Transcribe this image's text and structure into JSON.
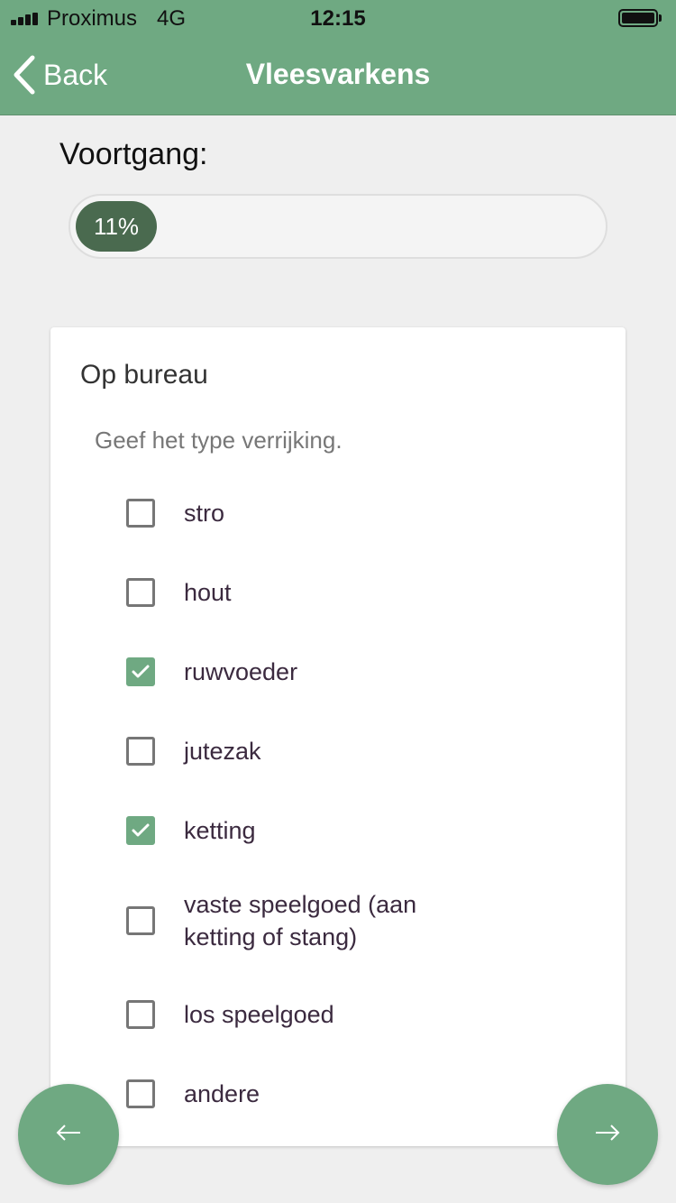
{
  "status_bar": {
    "carrier": "Proximus",
    "network": "4G",
    "time": "12:15"
  },
  "nav": {
    "back_label": "Back",
    "title": "Vleesvarkens"
  },
  "progress": {
    "label": "Voortgang:",
    "value_text": "11%",
    "value": 0.11
  },
  "card": {
    "title": "Op bureau",
    "subtitle": "Geef het type verrijking.",
    "options": [
      {
        "label": "stro",
        "checked": false
      },
      {
        "label": "hout",
        "checked": false
      },
      {
        "label": "ruwvoeder",
        "checked": true
      },
      {
        "label": "jutezak",
        "checked": false
      },
      {
        "label": "ketting",
        "checked": true
      },
      {
        "label": "vaste speelgoed (aan ketting of stang)",
        "checked": false
      },
      {
        "label": "los speelgoed",
        "checked": false
      },
      {
        "label": "andere",
        "checked": false
      }
    ]
  },
  "colors": {
    "accent": "#6fa982",
    "progress_fill": "#4a6a4f",
    "background": "#efefef"
  },
  "icons": {
    "back": "chevron-left-icon",
    "prev": "arrow-left-icon",
    "next": "arrow-right-icon",
    "check": "check-icon"
  }
}
